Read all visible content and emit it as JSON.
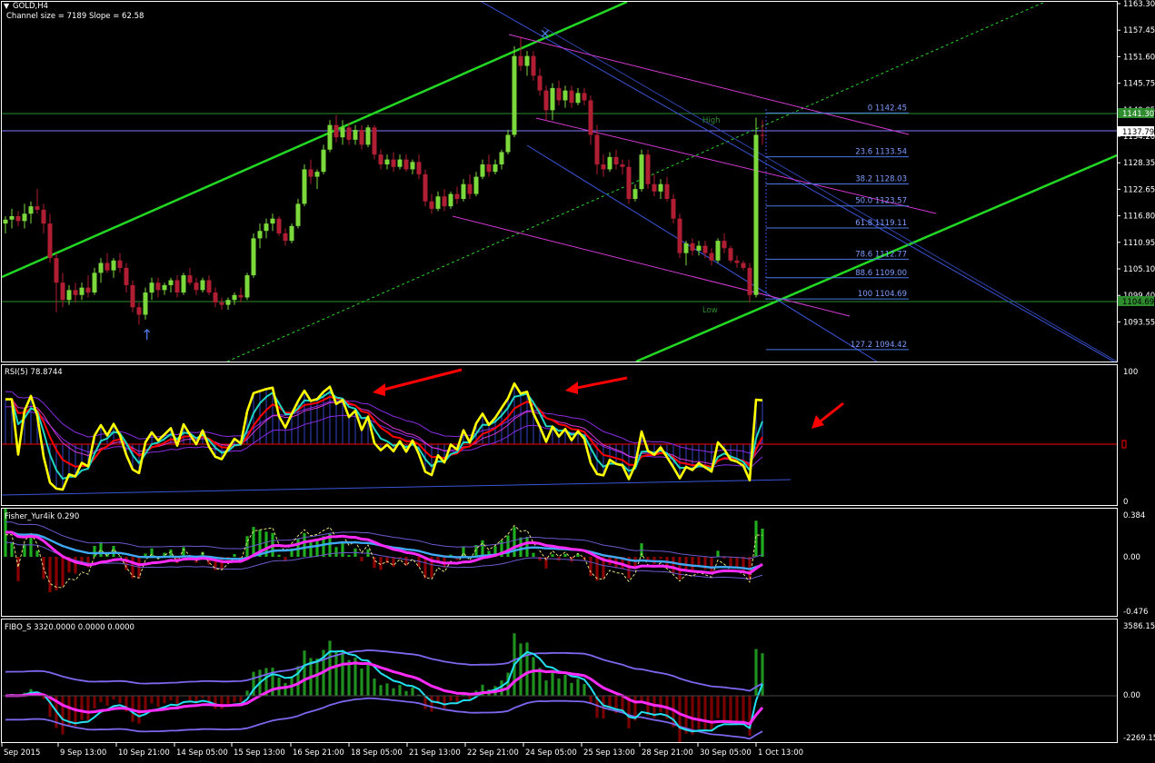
{
  "window": {
    "symbol": "GOLD,H4",
    "info": "Channel size = 7189 Slope = 62.58"
  },
  "colors": {
    "bg": "#000000",
    "grid": "#ffffff",
    "bull": "#7cd93b",
    "bear": "#b01e34",
    "channel": "#22d822",
    "pink": "#d438d4",
    "blue": "#3a55d8",
    "fibo": "#4a78e0",
    "yellow": "#ffff00",
    "red": "#ff0000",
    "cyan": "#22e0f0",
    "magenta": "#ff2bff",
    "hl": "#2e8b2e",
    "arrow": "#ff0000"
  },
  "price_axis": {
    "labels": [
      "1163.30",
      "1157.45",
      "1151.60",
      "1145.75",
      "1140.05",
      "1134.20",
      "1128.35",
      "1122.65",
      "1116.80",
      "1110.95",
      "1105.10",
      "1099.40",
      "1093.55"
    ],
    "current_price": "1137.79",
    "high_price": "1141.30",
    "low_price": "1104.69"
  },
  "time_axis": {
    "labels": [
      "Sep 2015",
      "9 Sep 13:00",
      "10 Sep 21:00",
      "14 Sep 05:00",
      "15 Sep 13:00",
      "16 Sep 21:00",
      "18 Sep 05:00",
      "21 Sep 13:00",
      "22 Sep 21:00",
      "24 Sep 05:00",
      "25 Sep 13:00",
      "28 Sep 21:00",
      "30 Sep 05:00",
      "1 Oct 13:00"
    ]
  },
  "fibo": {
    "high_label": "High",
    "low_label": "Low",
    "levels": [
      {
        "label": "0 1142.45",
        "price": 1142.45
      },
      {
        "label": "23.6 1133.54",
        "price": 1133.54
      },
      {
        "label": "38.2 1128.03",
        "price": 1128.03
      },
      {
        "label": "50.0 1123.57",
        "price": 1123.57
      },
      {
        "label": "61.8 1119.11",
        "price": 1119.11
      },
      {
        "label": "78.6 1112.77",
        "price": 1112.77
      },
      {
        "label": "88.6 1109.00",
        "price": 1109.0
      },
      {
        "label": "100 1104.69",
        "price": 1104.69
      },
      {
        "label": "127.2 1094.42",
        "price": 1094.42
      }
    ]
  },
  "panels": {
    "rsi": {
      "title": "RSI(5) 78.8744",
      "labels": [
        "100",
        "0"
      ]
    },
    "fisher": {
      "title": "Fisher_Yur4ik 0.290",
      "labels": [
        "0.384",
        "0.00",
        "-0.476"
      ]
    },
    "fibo_s": {
      "title": "FIBO_S 3320.0000 0.0000 0.0000",
      "labels": [
        "3586.15",
        "0.00",
        "-2269.15"
      ]
    }
  },
  "chart_data": {
    "type": "candlestick",
    "symbol": "GOLD",
    "timeframe": "H4",
    "ylim": [
      1092,
      1166
    ],
    "candles": [
      [
        1120.0,
        1121.5,
        1118.0,
        1120.8
      ],
      [
        1120.8,
        1123.0,
        1119.0,
        1121.5
      ],
      [
        1121.5,
        1122.5,
        1119.5,
        1120.5
      ],
      [
        1120.5,
        1124.0,
        1119.0,
        1122.0
      ],
      [
        1122.0,
        1124.5,
        1120.0,
        1123.5
      ],
      [
        1123.5,
        1127.0,
        1122.0,
        1122.8
      ],
      [
        1122.8,
        1124.0,
        1118.0,
        1120.0
      ],
      [
        1120.0,
        1122.0,
        1112.0,
        1113.0
      ],
      [
        1113.0,
        1114.0,
        1102.0,
        1108.0
      ],
      [
        1108.0,
        1110.0,
        1103.0,
        1104.5
      ],
      [
        1104.5,
        1107.5,
        1103.5,
        1106.5
      ],
      [
        1106.5,
        1108.0,
        1104.0,
        1105.5
      ],
      [
        1105.5,
        1108.0,
        1104.5,
        1107.0
      ],
      [
        1107.0,
        1109.5,
        1105.0,
        1106.0
      ],
      [
        1106.0,
        1111.0,
        1105.5,
        1110.0
      ],
      [
        1110.0,
        1113.0,
        1108.0,
        1112.0
      ],
      [
        1112.0,
        1114.0,
        1110.0,
        1110.5
      ],
      [
        1110.5,
        1113.0,
        1109.0,
        1112.5
      ],
      [
        1112.5,
        1114.0,
        1110.0,
        1111.0
      ],
      [
        1111.0,
        1112.0,
        1106.0,
        1107.5
      ],
      [
        1107.5,
        1108.5,
        1102.0,
        1103.0
      ],
      [
        1103.0,
        1104.0,
        1099.5,
        1101.5
      ],
      [
        1101.5,
        1107.0,
        1100.5,
        1106.0
      ],
      [
        1106.0,
        1109.0,
        1104.5,
        1108.0
      ],
      [
        1108.0,
        1109.0,
        1105.0,
        1106.5
      ],
      [
        1106.5,
        1108.0,
        1105.5,
        1107.5
      ],
      [
        1107.5,
        1109.0,
        1106.0,
        1108.5
      ],
      [
        1108.5,
        1109.5,
        1105.0,
        1106.0
      ],
      [
        1106.0,
        1110.0,
        1105.5,
        1109.5
      ],
      [
        1109.5,
        1111.0,
        1107.5,
        1108.0
      ],
      [
        1108.0,
        1109.0,
        1105.5,
        1106.5
      ],
      [
        1106.5,
        1109.0,
        1106.0,
        1108.5
      ],
      [
        1108.5,
        1109.5,
        1105.5,
        1106.0
      ],
      [
        1106.0,
        1107.0,
        1103.0,
        1104.0
      ],
      [
        1104.0,
        1105.0,
        1102.5,
        1103.5
      ],
      [
        1103.5,
        1105.0,
        1102.5,
        1104.5
      ],
      [
        1104.5,
        1106.0,
        1103.5,
        1105.5
      ],
      [
        1105.5,
        1107.0,
        1104.0,
        1105.0
      ],
      [
        1105.0,
        1110.0,
        1104.5,
        1109.5
      ],
      [
        1109.5,
        1118.0,
        1109.0,
        1117.0
      ],
      [
        1117.0,
        1120.0,
        1115.0,
        1118.5
      ],
      [
        1118.5,
        1121.0,
        1117.0,
        1120.0
      ],
      [
        1120.0,
        1122.0,
        1118.5,
        1121.0
      ],
      [
        1121.0,
        1121.5,
        1117.5,
        1118.0
      ],
      [
        1118.0,
        1119.0,
        1115.5,
        1116.5
      ],
      [
        1116.5,
        1120.0,
        1116.0,
        1119.5
      ],
      [
        1119.5,
        1125.0,
        1119.0,
        1124.0
      ],
      [
        1124.0,
        1132.0,
        1123.5,
        1131.0
      ],
      [
        1131.0,
        1133.0,
        1128.0,
        1129.5
      ],
      [
        1129.5,
        1131.0,
        1127.0,
        1130.5
      ],
      [
        1130.5,
        1136.0,
        1130.0,
        1135.0
      ],
      [
        1135.0,
        1141.0,
        1134.5,
        1140.0
      ],
      [
        1140.0,
        1142.0,
        1136.5,
        1137.5
      ],
      [
        1137.5,
        1141.0,
        1136.0,
        1139.5
      ],
      [
        1139.5,
        1140.5,
        1136.0,
        1137.0
      ],
      [
        1137.0,
        1140.0,
        1136.0,
        1139.0
      ],
      [
        1139.0,
        1140.0,
        1135.0,
        1136.0
      ],
      [
        1136.0,
        1140.0,
        1135.5,
        1139.5
      ],
      [
        1139.5,
        1140.0,
        1133.0,
        1134.0
      ],
      [
        1134.0,
        1135.0,
        1131.0,
        1132.0
      ],
      [
        1132.0,
        1134.0,
        1131.0,
        1133.0
      ],
      [
        1133.0,
        1134.5,
        1130.5,
        1131.5
      ],
      [
        1131.5,
        1134.0,
        1131.0,
        1133.0
      ],
      [
        1133.0,
        1134.0,
        1130.5,
        1131.0
      ],
      [
        1131.0,
        1133.0,
        1130.0,
        1132.5
      ],
      [
        1132.5,
        1134.0,
        1129.0,
        1130.0
      ],
      [
        1130.0,
        1131.0,
        1123.5,
        1124.5
      ],
      [
        1124.5,
        1126.0,
        1122.0,
        1123.0
      ],
      [
        1123.0,
        1126.5,
        1122.5,
        1125.5
      ],
      [
        1125.5,
        1127.0,
        1122.5,
        1123.5
      ],
      [
        1123.5,
        1126.5,
        1123.0,
        1126.0
      ],
      [
        1126.0,
        1127.5,
        1124.0,
        1125.0
      ],
      [
        1125.0,
        1129.0,
        1124.5,
        1128.0
      ],
      [
        1128.0,
        1130.0,
        1125.0,
        1126.0
      ],
      [
        1126.0,
        1130.5,
        1125.5,
        1129.5
      ],
      [
        1129.5,
        1133.0,
        1129.0,
        1132.0
      ],
      [
        1132.0,
        1134.0,
        1129.5,
        1130.5
      ],
      [
        1130.5,
        1133.0,
        1130.0,
        1132.0
      ],
      [
        1132.0,
        1135.0,
        1131.0,
        1134.5
      ],
      [
        1134.5,
        1139.0,
        1134.0,
        1138.0
      ],
      [
        1138.0,
        1156.0,
        1137.5,
        1154.0
      ],
      [
        1154.0,
        1158.0,
        1151.0,
        1152.0
      ],
      [
        1152.0,
        1155.0,
        1150.0,
        1154.0
      ],
      [
        1154.0,
        1155.0,
        1149.0,
        1150.0
      ],
      [
        1150.0,
        1151.5,
        1146.0,
        1147.0
      ],
      [
        1147.0,
        1148.0,
        1141.0,
        1143.0
      ],
      [
        1143.0,
        1148.5,
        1141.0,
        1147.5
      ],
      [
        1147.5,
        1149.0,
        1144.0,
        1145.0
      ],
      [
        1145.0,
        1148.0,
        1143.5,
        1147.0
      ],
      [
        1147.0,
        1148.0,
        1143.5,
        1144.5
      ],
      [
        1144.5,
        1147.5,
        1144.0,
        1146.5
      ],
      [
        1146.5,
        1147.5,
        1144.0,
        1145.0
      ],
      [
        1145.0,
        1146.0,
        1136.0,
        1138.0
      ],
      [
        1138.0,
        1140.0,
        1130.0,
        1132.0
      ],
      [
        1132.0,
        1134.0,
        1129.5,
        1131.0
      ],
      [
        1131.0,
        1134.5,
        1130.5,
        1133.5
      ],
      [
        1133.5,
        1135.0,
        1131.0,
        1132.0
      ],
      [
        1132.0,
        1133.0,
        1130.0,
        1131.5
      ],
      [
        1131.5,
        1133.0,
        1124.0,
        1125.0
      ],
      [
        1125.0,
        1128.0,
        1124.5,
        1127.0
      ],
      [
        1127.0,
        1135.0,
        1126.5,
        1134.0
      ],
      [
        1134.0,
        1135.0,
        1127.0,
        1128.0
      ],
      [
        1128.0,
        1130.0,
        1125.5,
        1126.5
      ],
      [
        1126.5,
        1129.0,
        1125.0,
        1128.0
      ],
      [
        1128.0,
        1129.5,
        1124.5,
        1125.0
      ],
      [
        1125.0,
        1126.0,
        1120.0,
        1121.0
      ],
      [
        1121.0,
        1122.0,
        1113.0,
        1114.0
      ],
      [
        1114.0,
        1116.5,
        1111.5,
        1116.0
      ],
      [
        1116.0,
        1117.0,
        1113.5,
        1114.5
      ],
      [
        1114.5,
        1116.5,
        1113.5,
        1115.5
      ],
      [
        1115.5,
        1116.5,
        1113.0,
        1114.0
      ],
      [
        1114.0,
        1115.0,
        1111.5,
        1112.5
      ],
      [
        1112.5,
        1117.0,
        1112.0,
        1116.5
      ],
      [
        1116.5,
        1118.0,
        1114.0,
        1115.0
      ],
      [
        1115.0,
        1115.5,
        1112.0,
        1112.5
      ],
      [
        1112.5,
        1113.5,
        1111.0,
        1112.0
      ],
      [
        1112.0,
        1112.5,
        1110.5,
        1111.0
      ],
      [
        1111.0,
        1112.0,
        1104.0,
        1105.5
      ],
      [
        1105.5,
        1141.5,
        1105.0,
        1138.0
      ],
      [
        1138.0,
        1141.0,
        1136.0,
        1137.8
      ]
    ]
  }
}
